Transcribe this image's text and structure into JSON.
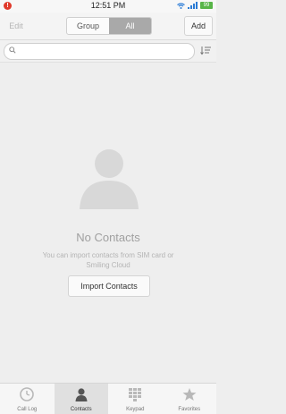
{
  "status_bar": {
    "time": "12:51 PM",
    "alert_glyph": "!",
    "battery_label": "99"
  },
  "header": {
    "edit_label": "Edit",
    "segments": [
      "Group",
      "All"
    ],
    "active_segment": "All",
    "add_label": "Add"
  },
  "search": {
    "placeholder": ""
  },
  "empty_state": {
    "title": "No Contacts",
    "hint": "You can import contacts from SIM card or Smiling Cloud",
    "import_button": "Import Contacts"
  },
  "tabs": [
    {
      "label": "Call Log",
      "icon": "clock-icon"
    },
    {
      "label": "Contacts",
      "icon": "person-icon",
      "active": true
    },
    {
      "label": "Keypad",
      "icon": "keypad-icon"
    },
    {
      "label": "Favorites",
      "icon": "star-icon"
    }
  ],
  "colors": {
    "alert": "#e03a2b",
    "battery": "#58b548",
    "signal": "#2a7bd6",
    "active_segment": "#a9a9a9"
  }
}
